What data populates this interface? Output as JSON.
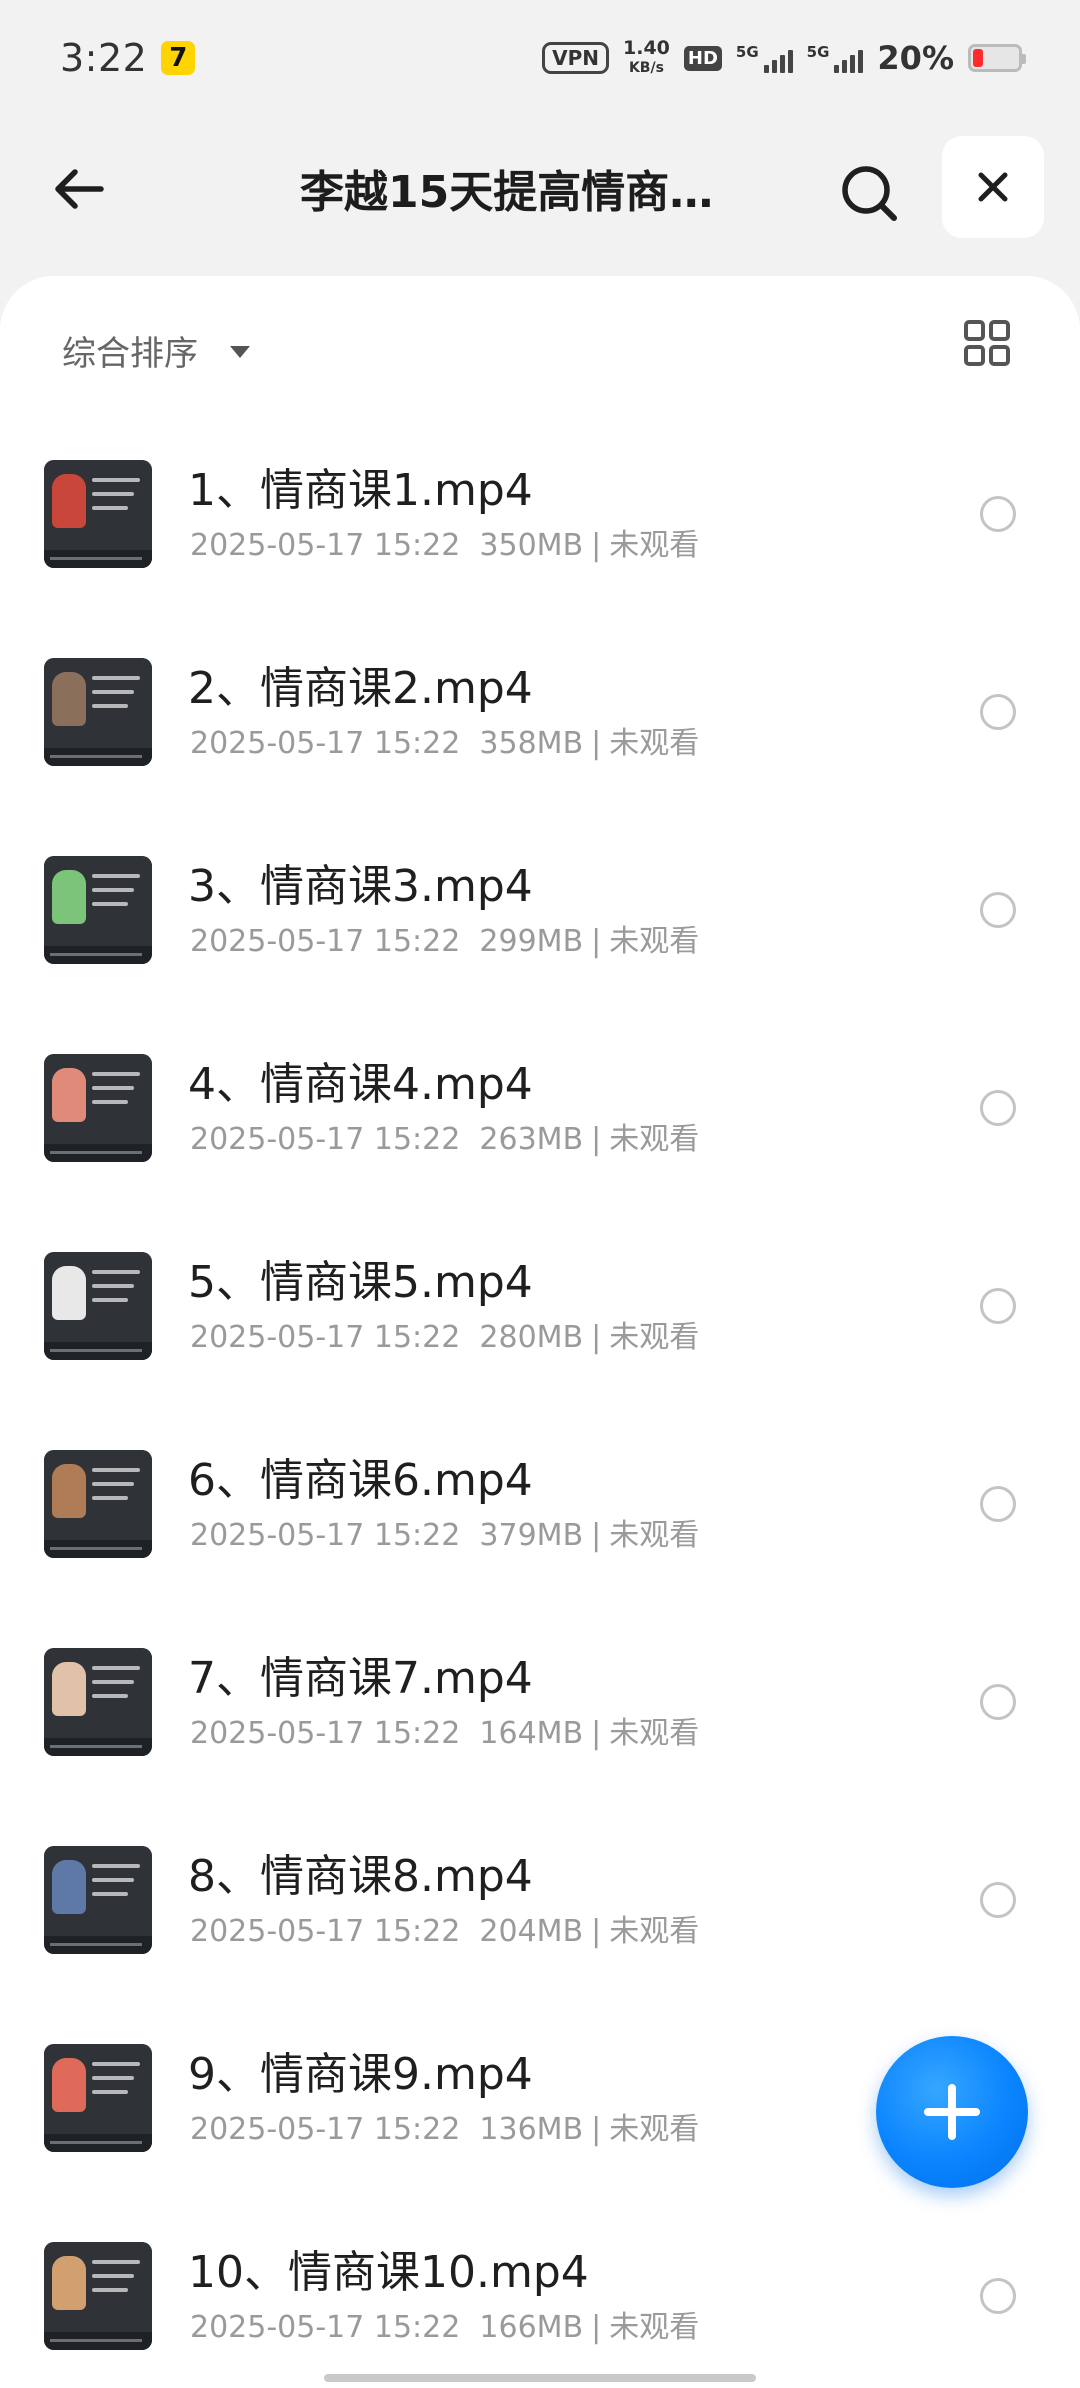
{
  "status_bar": {
    "time": "3:22",
    "app_badge": "7",
    "vpn": "VPN",
    "net_speed_value": "1.40",
    "net_speed_unit": "KB/s",
    "hd": "HD",
    "signal1_label": "5G",
    "signal2_label": "5G",
    "battery_percent": "20%"
  },
  "header": {
    "title": "李越15天提高情商…"
  },
  "toolbar": {
    "sort_label": "综合排序"
  },
  "files": [
    {
      "name": "1、情商课1.mp4",
      "date": "2025-05-17 15:22",
      "size": "350MB",
      "status": "未观看",
      "thumb_color": "#c8473a"
    },
    {
      "name": "2、情商课2.mp4",
      "date": "2025-05-17 15:22",
      "size": "358MB",
      "status": "未观看",
      "thumb_color": "#8a6f5a"
    },
    {
      "name": "3、情商课3.mp4",
      "date": "2025-05-17 15:22",
      "size": "299MB",
      "status": "未观看",
      "thumb_color": "#7cc47a"
    },
    {
      "name": "4、情商课4.mp4",
      "date": "2025-05-17 15:22",
      "size": "263MB",
      "status": "未观看",
      "thumb_color": "#e08a7a"
    },
    {
      "name": "5、情商课5.mp4",
      "date": "2025-05-17 15:22",
      "size": "280MB",
      "status": "未观看",
      "thumb_color": "#e8e8e8"
    },
    {
      "name": "6、情商课6.mp4",
      "date": "2025-05-17 15:22",
      "size": "379MB",
      "status": "未观看",
      "thumb_color": "#b07c55"
    },
    {
      "name": "7、情商课7.mp4",
      "date": "2025-05-17 15:22",
      "size": "164MB",
      "status": "未观看",
      "thumb_color": "#e0c2a8"
    },
    {
      "name": "8、情商课8.mp4",
      "date": "2025-05-17 15:22",
      "size": "204MB",
      "status": "未观看",
      "thumb_color": "#5e78a8"
    },
    {
      "name": "9、情商课9.mp4",
      "date": "2025-05-17 15:22",
      "size": "136MB",
      "status": "未观看",
      "thumb_color": "#e06a5a"
    },
    {
      "name": "10、情商课10.mp4",
      "date": "2025-05-17 15:22",
      "size": "166MB",
      "status": "未观看",
      "thumb_color": "#d2a070"
    }
  ],
  "colors": {
    "accent": "#0a84ff",
    "battery_low": "#ff2a2a"
  },
  "icons": {
    "back": "arrow-left-icon",
    "search": "search-icon",
    "close": "close-icon",
    "sort": "caret-down-icon",
    "grid": "grid-view-icon",
    "fab": "plus-icon"
  }
}
